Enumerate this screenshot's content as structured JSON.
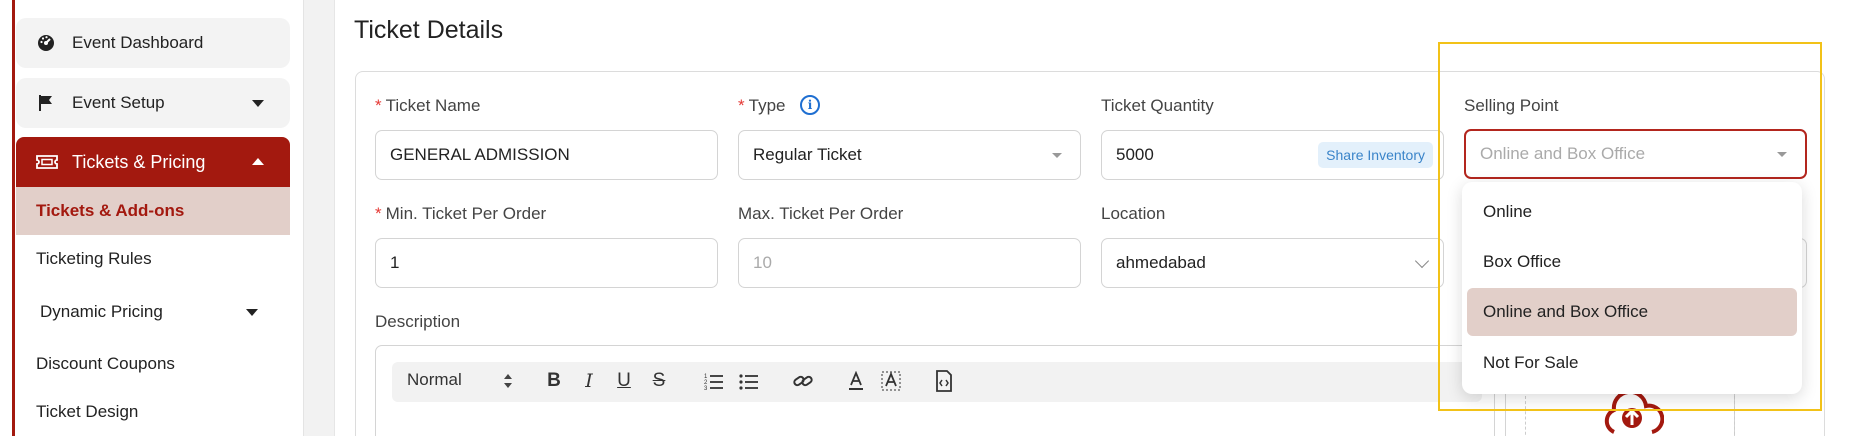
{
  "sidebar": {
    "items": [
      {
        "label": "Event Dashboard"
      },
      {
        "label": "Event Setup"
      },
      {
        "label": "Tickets & Pricing"
      }
    ],
    "sub_items": [
      {
        "label": "Tickets & Add-ons"
      },
      {
        "label": "Ticketing Rules"
      },
      {
        "label": "Dynamic Pricing"
      },
      {
        "label": "Discount Coupons"
      },
      {
        "label": "Ticket Design"
      }
    ]
  },
  "main": {
    "title": "Ticket Details",
    "fields": {
      "ticket_name": {
        "label": "Ticket Name",
        "value": "GENERAL ADMISSION"
      },
      "type": {
        "label": "Type",
        "value": "Regular Ticket"
      },
      "ticket_quantity": {
        "label": "Ticket Quantity",
        "value": "5000",
        "badge": "Share Inventory"
      },
      "selling_point": {
        "label": "Selling Point",
        "placeholder": "Online and Box Office"
      },
      "min_per_order": {
        "label": "Min. Ticket Per Order",
        "value": "1"
      },
      "max_per_order": {
        "label": "Max. Ticket Per Order",
        "placeholder": "10"
      },
      "location": {
        "label": "Location",
        "value": "ahmedabad"
      },
      "description": {
        "label": "Description"
      }
    },
    "editor": {
      "format": "Normal",
      "tools": [
        "bold-icon",
        "italic-icon",
        "underline-icon",
        "strikethrough-icon",
        "ordered-list-icon",
        "bullet-list-icon",
        "link-icon",
        "text-color-icon",
        "highlight-icon",
        "code-file-icon"
      ]
    },
    "dropdown": {
      "options": [
        "Online",
        "Box Office",
        "Online and Box Office",
        "Not For Sale"
      ],
      "selected": "Online and Box Office"
    }
  },
  "colors": {
    "brand": "#a3190f",
    "selected_bg": "#e2cfc9",
    "highlight": "#f2c218",
    "info": "#1f6fd1"
  }
}
